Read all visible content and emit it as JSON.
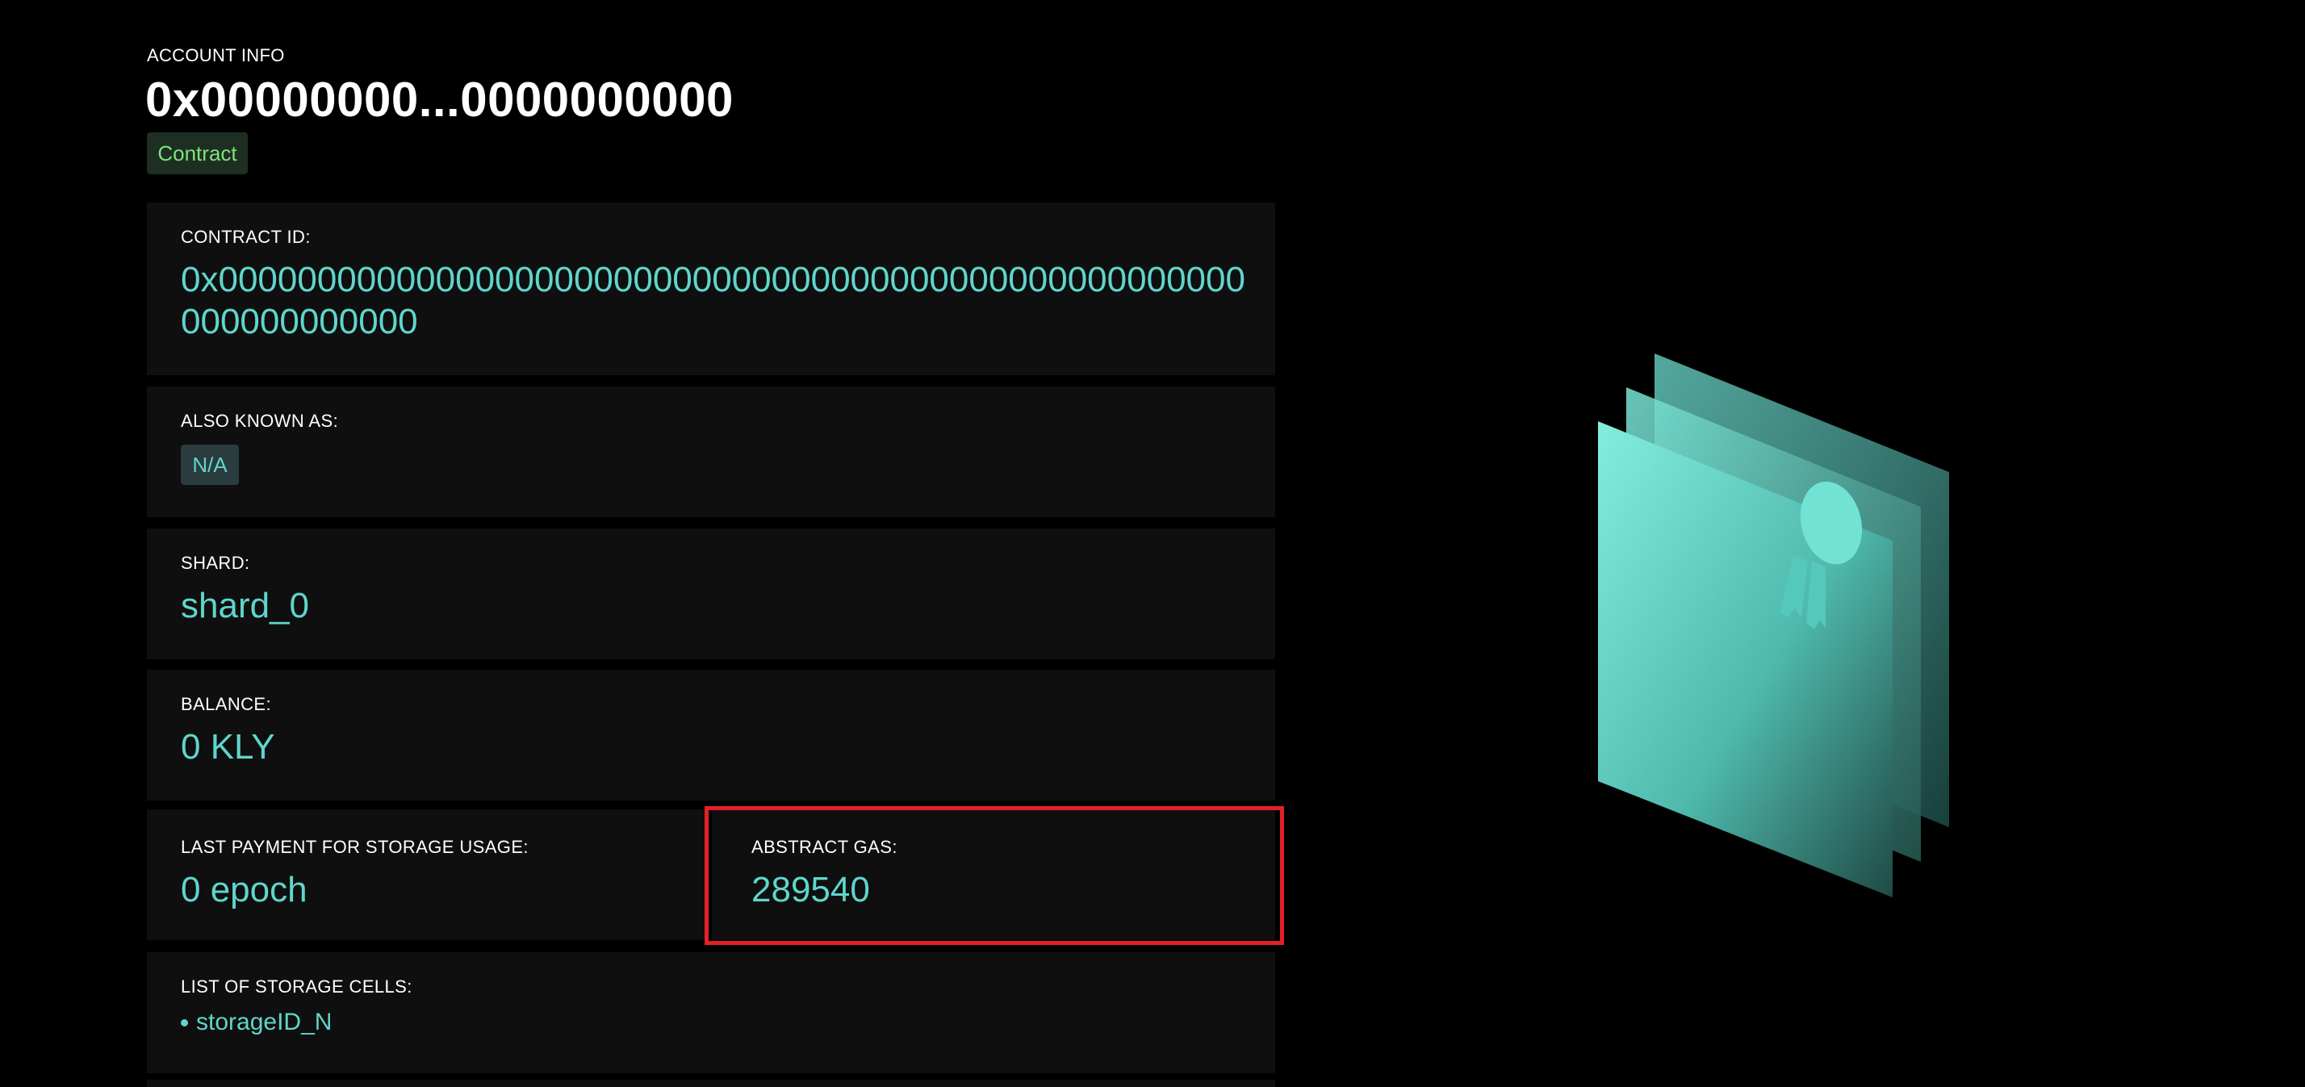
{
  "header": {
    "label": "ACCOUNT INFO",
    "address": "0x00000000...0000000000",
    "type_badge": "Contract"
  },
  "contract": {
    "label": "CONTRACT ID:",
    "value": "0x0000000000000000000000000000000000000000000000000000000000000000"
  },
  "aka": {
    "label": "ALSO KNOWN AS:",
    "value": "N/A"
  },
  "shard": {
    "label": "SHARD:",
    "value": "shard_0"
  },
  "balance": {
    "label": "BALANCE:",
    "value": "0 KLY"
  },
  "storage_payment": {
    "label": "LAST PAYMENT FOR STORAGE USAGE:",
    "value": "0 epoch"
  },
  "gas": {
    "label": "ABSTRACT GAS:",
    "value": "289540"
  },
  "storage_cells": {
    "label": "LIST OF STORAGE CELLS:",
    "items": [
      "storageID_N"
    ]
  },
  "colors": {
    "background": "#000000",
    "card": "#0f0f0f",
    "accent": "#5fd6cb",
    "badge_green": "#7be37b",
    "highlight": "#e3202a"
  },
  "illustration": {
    "icon": "certificate-icon"
  }
}
